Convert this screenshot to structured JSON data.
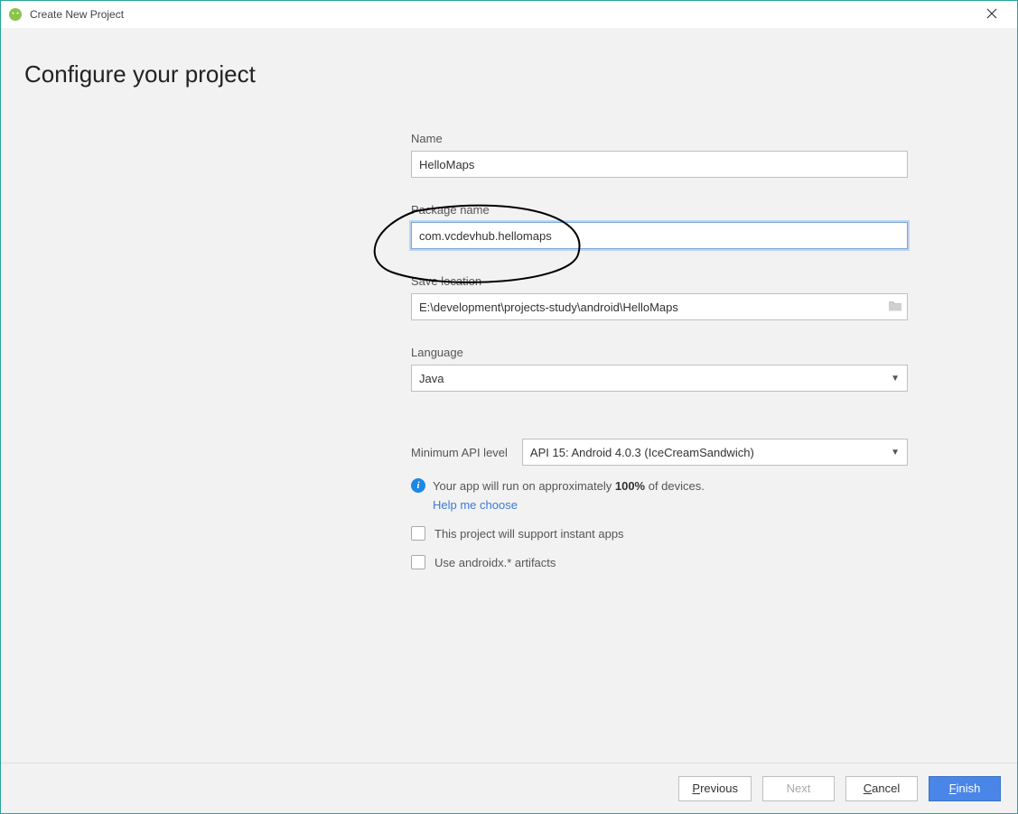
{
  "window": {
    "title": "Create New Project"
  },
  "header": {
    "title": "Configure your project"
  },
  "fields": {
    "name": {
      "label": "Name",
      "value": "HelloMaps"
    },
    "package": {
      "label": "Package name",
      "value": "com.vcdevhub.hellomaps"
    },
    "save": {
      "label": "Save location",
      "value": "E:\\development\\projects-study\\android\\HelloMaps"
    },
    "language": {
      "label": "Language",
      "value": "Java"
    },
    "api": {
      "label": "Minimum API level",
      "value": "API 15: Android 4.0.3 (IceCreamSandwich)"
    }
  },
  "info": {
    "prefix": "Your app will run on approximately ",
    "percent": "100%",
    "suffix": " of devices.",
    "help": "Help me choose"
  },
  "checks": {
    "instant": "This project will support instant apps",
    "androidx": "Use androidx.* artifacts"
  },
  "buttons": {
    "previous": {
      "u": "P",
      "rest": "revious"
    },
    "next": "Next",
    "cancel": {
      "u": "C",
      "rest": "ancel"
    },
    "finish": {
      "u": "F",
      "rest": "inish"
    }
  }
}
